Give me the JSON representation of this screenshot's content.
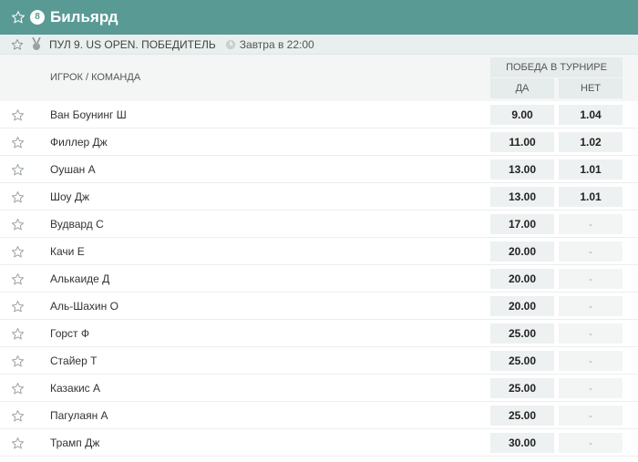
{
  "header": {
    "title": "Бильярд",
    "sport_icon": "billiard-ball-icon",
    "ball_number": "8"
  },
  "event": {
    "name": "ПУЛ 9. US OPEN. ПОБЕДИТЕЛЬ",
    "time": "Завтра в 22:00"
  },
  "columns": {
    "player": "ИГРОК / КОМАНДА",
    "market": "ПОБЕДА В ТУРНИРЕ",
    "yes": "ДА",
    "no": "НЕТ"
  },
  "rows": [
    {
      "name": "Ван Боунинг Ш",
      "yes": "9.00",
      "no": "1.04"
    },
    {
      "name": "Филлер Дж",
      "yes": "11.00",
      "no": "1.02"
    },
    {
      "name": "Оушан А",
      "yes": "13.00",
      "no": "1.01"
    },
    {
      "name": "Шоу Дж",
      "yes": "13.00",
      "no": "1.01"
    },
    {
      "name": "Вудвард С",
      "yes": "17.00",
      "no": "-"
    },
    {
      "name": "Качи Е",
      "yes": "20.00",
      "no": "-"
    },
    {
      "name": "Алькаиде Д",
      "yes": "20.00",
      "no": "-"
    },
    {
      "name": "Аль-Шахин О",
      "yes": "20.00",
      "no": "-"
    },
    {
      "name": "Горст Ф",
      "yes": "25.00",
      "no": "-"
    },
    {
      "name": "Стайер Т",
      "yes": "25.00",
      "no": "-"
    },
    {
      "name": "Казакис А",
      "yes": "25.00",
      "no": "-"
    },
    {
      "name": "Пагулаян А",
      "yes": "25.00",
      "no": "-"
    },
    {
      "name": "Трамп Дж",
      "yes": "30.00",
      "no": "-"
    }
  ]
}
